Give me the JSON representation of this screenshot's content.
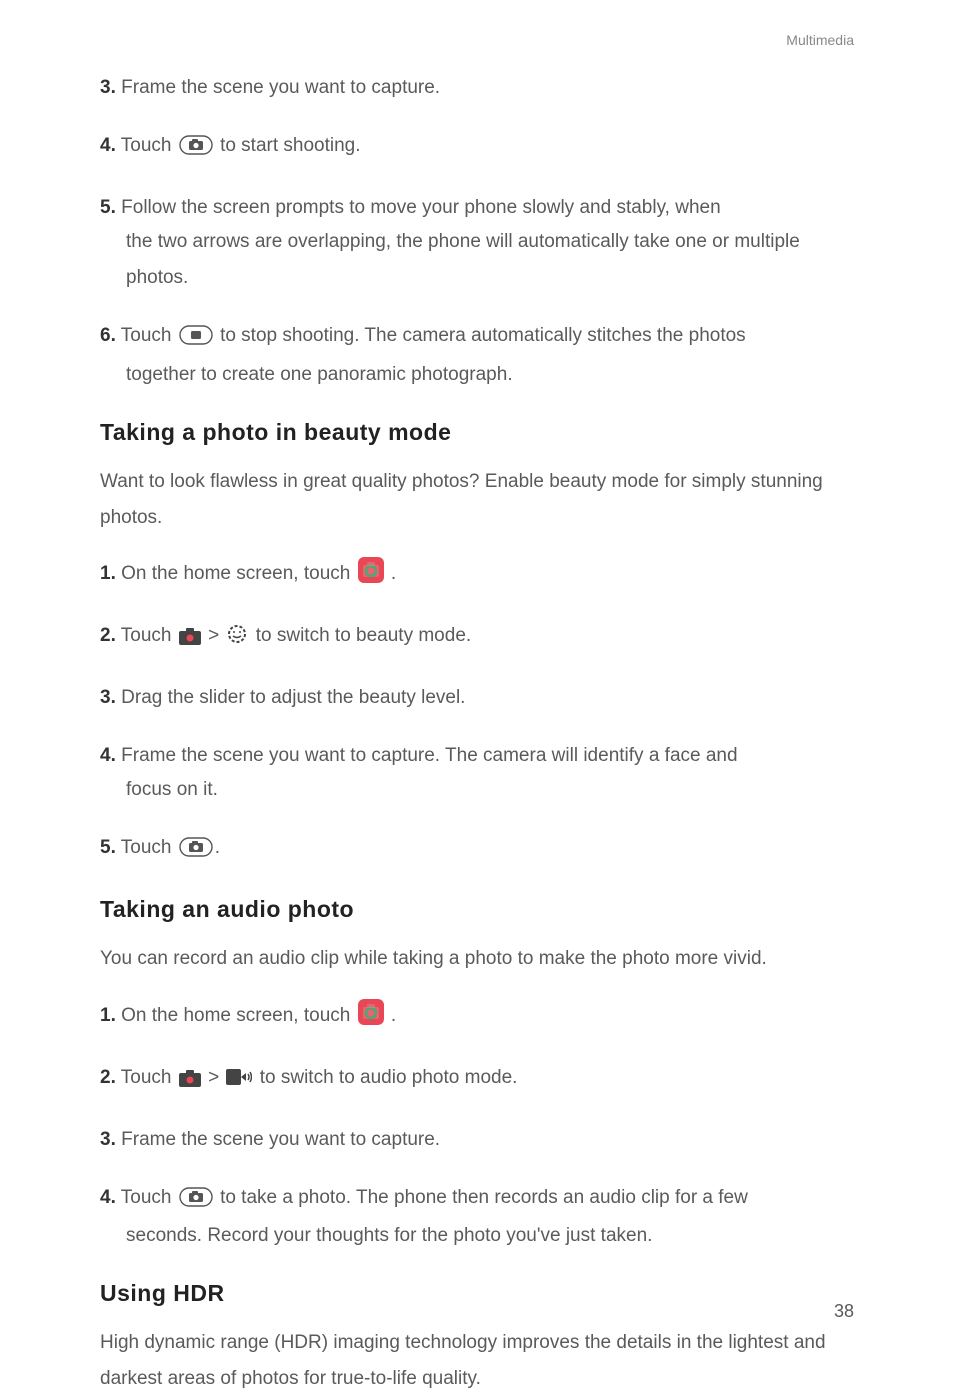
{
  "header": {
    "section_label": "Multimedia"
  },
  "page_number": "38",
  "sections": {
    "s1_steps": {
      "s3": {
        "num": "3.",
        "text": "Frame the scene you want to capture."
      },
      "s4": {
        "num": "4.",
        "pre": "Touch ",
        "post": "to start shooting."
      },
      "s5": {
        "num": "5.",
        "text": "Follow the screen prompts to move your phone slowly and stably, when",
        "cont": "the two arrows are overlapping, the phone will automatically take one or multiple photos."
      },
      "s6": {
        "num": "6.",
        "pre": "Touch ",
        "mid": " to stop shooting. The camera automatically stitches the photos",
        "cont": "together to create one panoramic photograph."
      }
    },
    "beauty": {
      "heading": "Taking a photo in beauty mode",
      "intro": "Want to look flawless in great quality photos? Enable beauty mode for simply stunning photos.",
      "s1": {
        "num": "1.",
        "pre": "On the home screen, touch ",
        "post": " ."
      },
      "s2": {
        "num": "2.",
        "pre": "Touch ",
        "mid": " > ",
        "post": " to switch to beauty mode."
      },
      "s3": {
        "num": "3.",
        "text": "Drag the slider to adjust the beauty level."
      },
      "s4": {
        "num": "4.",
        "text": "Frame the scene you want to capture. The camera will identify a face and",
        "cont": "focus on it."
      },
      "s5": {
        "num": "5.",
        "pre": "Touch ",
        "post": "."
      }
    },
    "audio": {
      "heading": "Taking an audio photo",
      "intro": "You can record an audio clip while taking a photo to make the photo more vivid.",
      "s1": {
        "num": "1.",
        "pre": "On the home screen, touch ",
        "post": " ."
      },
      "s2": {
        "num": "2.",
        "pre": "Touch ",
        "mid": " > ",
        "post": "to switch to audio photo mode."
      },
      "s3": {
        "num": "3.",
        "text": "Frame the scene you want to capture."
      },
      "s4": {
        "num": "4.",
        "pre": "Touch ",
        "mid": "to take a photo. The phone then records an audio clip for a few",
        "cont": "seconds. Record your thoughts for the photo you've just taken."
      }
    },
    "hdr": {
      "heading": "Using HDR",
      "intro": "High dynamic range (HDR) imaging technology improves the details in the lightest and darkest areas of photos for true-to-life quality."
    }
  }
}
